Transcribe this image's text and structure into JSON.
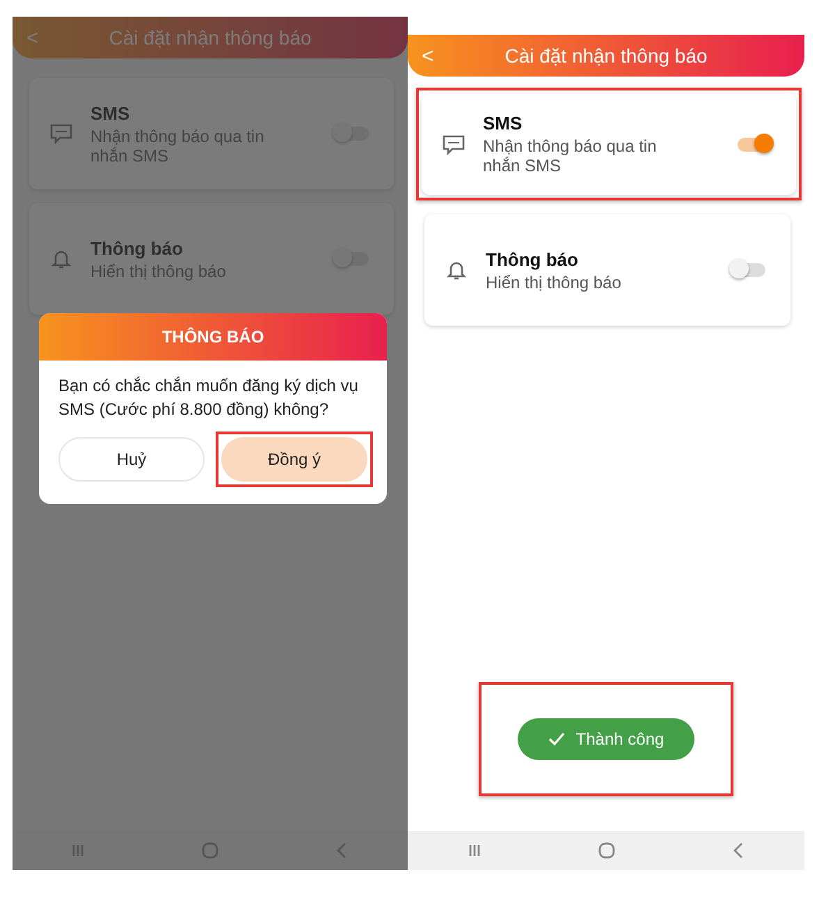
{
  "screens": [
    {
      "header": {
        "back": "<",
        "title": "Cài đặt nhận thông báo"
      },
      "settings": [
        {
          "kind": "sms",
          "title": "SMS",
          "subtitle": "Nhận thông báo qua tin nhắn SMS",
          "on": false,
          "highlighted": false
        },
        {
          "kind": "bell",
          "title": "Thông báo",
          "subtitle": "Hiển thị thông báo",
          "on": false,
          "highlighted": false
        }
      ],
      "dialog": {
        "title": "THÔNG BÁO",
        "message": "Bạn có chắc chắn muốn đăng ký dịch vụ SMS (Cước phí 8.800 đồng) không?",
        "buttons": [
          {
            "label": "Huỷ",
            "primary": false,
            "highlighted": false
          },
          {
            "label": "Đồng ý",
            "primary": true,
            "highlighted": true
          }
        ]
      }
    },
    {
      "header": {
        "back": "<",
        "title": "Cài đặt nhận thông báo"
      },
      "settings": [
        {
          "kind": "sms",
          "title": "SMS",
          "subtitle": "Nhận thông báo qua tin nhắn SMS",
          "on": true,
          "highlighted": true
        },
        {
          "kind": "bell",
          "title": "Thông báo",
          "subtitle": "Hiển thị thông báo",
          "on": false,
          "highlighted": false
        }
      ],
      "toast": {
        "text": "Thành công",
        "highlighted": true
      }
    }
  ]
}
